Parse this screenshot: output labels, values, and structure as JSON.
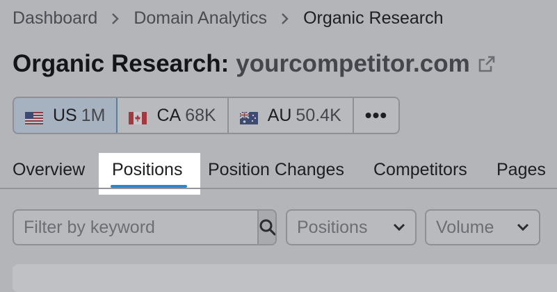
{
  "breadcrumb": {
    "items": [
      "Dashboard",
      "Domain Analytics",
      "Organic Research"
    ]
  },
  "title": {
    "label": "Organic Research:",
    "domain": "yourcompetitor.com"
  },
  "databases": [
    {
      "code": "US",
      "count": "1M",
      "flag": "us-flag-icon",
      "selected": true
    },
    {
      "code": "CA",
      "count": "68K",
      "flag": "ca-flag-icon",
      "selected": false
    },
    {
      "code": "AU",
      "count": "50.4K",
      "flag": "au-flag-icon",
      "selected": false
    }
  ],
  "more_label": "•••",
  "tabs": [
    {
      "label": "Overview",
      "active": false
    },
    {
      "label": "Positions",
      "active": true
    },
    {
      "label": "Position Changes",
      "active": false
    },
    {
      "label": "Competitors",
      "active": false
    },
    {
      "label": "Pages",
      "active": false
    }
  ],
  "filters": {
    "search_placeholder": "Filter by keyword",
    "positions_label": "Positions",
    "volume_label": "Volume"
  },
  "colors": {
    "accent": "#2a86c9",
    "overlay": "#b4b5b9"
  }
}
